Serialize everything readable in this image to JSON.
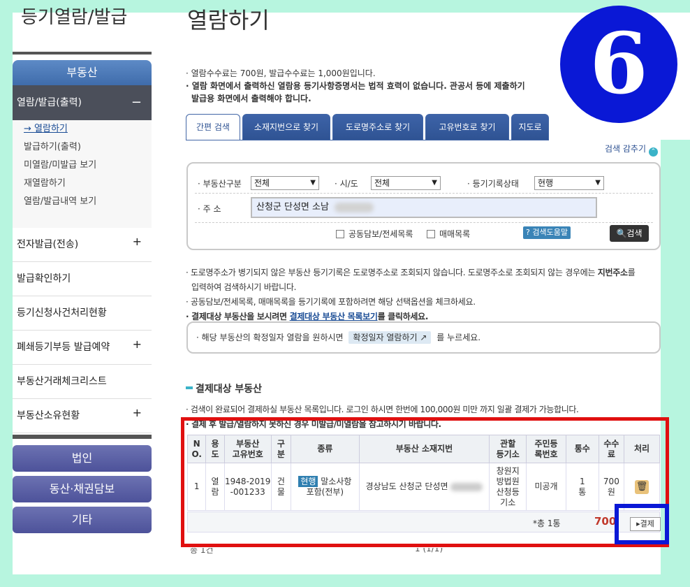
{
  "sidebar": {
    "title": "등기열람/발급",
    "realestate": "부동산",
    "open_menu": "열람/발급(출력)",
    "open_symbol": "−",
    "sub_items": [
      "열람하기",
      "발급하기(출력)",
      "미열람/미발급 보기",
      "재열람하기",
      "열람/발급내역 보기"
    ],
    "items": [
      {
        "label": "전자발급(전송)",
        "symbol": "+"
      },
      {
        "label": "발급확인하기",
        "symbol": ""
      },
      {
        "label": "등기신청사건처리현황",
        "symbol": ""
      },
      {
        "label": "폐쇄등기부등 발급예약",
        "symbol": "+"
      },
      {
        "label": "부동산거래체크리스트",
        "symbol": ""
      },
      {
        "label": "부동산소유현황",
        "symbol": "+"
      }
    ],
    "categories": [
      "법인",
      "동산·채권담보",
      "기타"
    ]
  },
  "main": {
    "title": "열람하기",
    "notice1": "열람수수료는 700원, 발급수수료는 1,000원입니다.",
    "notice2": "열람 화면에서 출력하신 열람용 등기사항증명서는 법적 효력이 없습니다. 관공서 등에 제출하기",
    "notice3": "발급용 화면에서 출력해야 합니다.",
    "badge": "6",
    "tabs": [
      "간편 검색",
      "소재지번으로 찾기",
      "도로명주소로 찾기",
      "고유번호로 찾기",
      "지도로"
    ],
    "collapse": "검색 감추기",
    "collapse_icon": "⌃"
  },
  "search": {
    "type_label": "부동산구분",
    "type_value": "전체",
    "sido_label": "시/도",
    "sido_value": "전체",
    "status_label": "등기기록상태",
    "status_value": "현행",
    "addr_label": "주 소",
    "addr_value": "산청군 단성면 소남",
    "chk1": "공동담보/전세목록",
    "chk2": "매매목록",
    "help": "검색도움말",
    "help_icon": "?",
    "search_btn": "검색",
    "search_icon": "🔍"
  },
  "info": {
    "l1a": "도로명주소가 병기되지 않은 부동산 등기기록은 도로명주소로 조회되지 않습니다. 도로명주소로 조회되지 않는 경우에는 ",
    "l1b": "지번주소",
    "l1c": "를",
    "l2": "입력하여 검색하시기 바랍니다.",
    "l3": "공동담보/전세목록, 매매목록을 등기기록에 포함하려면 해당 선택옵션을 체크하세요.",
    "l4a": "결제대상 부동산을 보시려면 ",
    "l4b": "결제대상 부동산 목록보기",
    "l4c": "를 클릭하세요.",
    "confirm_a": "해당 부동산의 확정일자 열람을 원하시면",
    "confirm_btn": "확정일자 열람하기",
    "confirm_icon": "↗",
    "confirm_b": "를 누르세요."
  },
  "payment": {
    "title": "결제대상 부동산",
    "note1": "검색이 완료되어 결제하실 부동산 목록입니다. 로그인 하시면 한번에 100,000원 미만 까지 일괄 결제가 가능합니다.",
    "note2": "결제 후 발급/열람하지 못하신 경우 미발급/미열람을 참고하시기 바랍니다.",
    "headers": [
      "N\nO.",
      "용\n도",
      "부동산\n고유번호",
      "구\n분",
      "종류",
      "부동산 소재지번",
      "관할\n등기소",
      "주민등\n록번호",
      "통수",
      "수수\n료",
      "처리"
    ],
    "row": {
      "no": "1",
      "use": "열\n람",
      "id": "1948-2019\n-001233",
      "div": "건\n물",
      "kind_tag": "현행",
      "kind": "말소사항\n포함(전부)",
      "addr": "경상남도 산청군 단성면",
      "office": "창원지\n방법원\n산청등\n기소",
      "rrn": "미공개",
      "count": "1\n통",
      "fee": "700\n원",
      "delete_icon": "🗑"
    },
    "total": "*총 1통",
    "amount": "700",
    "pay_btn": "▸결제",
    "bottom_a": "총 1건",
    "bottom_b": "1 (1/1)"
  }
}
